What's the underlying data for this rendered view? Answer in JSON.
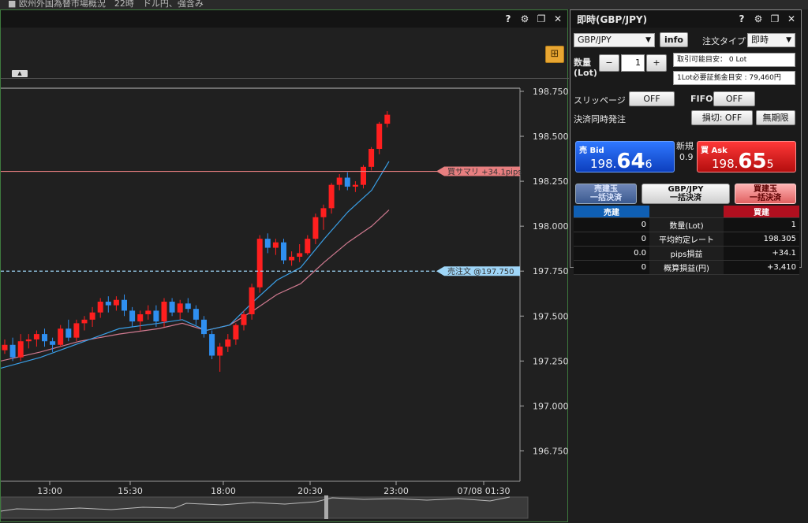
{
  "top_strip": {
    "text": "■ 欧州外国為替市場概況　22時　ドル円、強含み"
  },
  "chart_window": {
    "help": "?",
    "gear": "⚙",
    "restore": "❐",
    "close": "✕",
    "tile_icon": "⊞"
  },
  "chart_data": {
    "type": "candlestick",
    "y_ticks": [
      "198.750",
      "198.500",
      "198.250",
      "198.000",
      "197.750",
      "197.500",
      "197.250",
      "197.000",
      "196.750"
    ],
    "x_ticks": [
      "13:00",
      "15:30",
      "18:00",
      "20:30",
      "23:00",
      "07/08 01:30"
    ],
    "ylim": [
      196.66,
      198.82
    ],
    "candles": [
      [
        197.31,
        197.37,
        197.29,
        197.34
      ],
      [
        197.34,
        197.38,
        197.25,
        197.27
      ],
      [
        197.27,
        197.4,
        197.25,
        197.36
      ],
      [
        197.36,
        197.4,
        197.32,
        197.37
      ],
      [
        197.37,
        197.42,
        197.33,
        197.4
      ],
      [
        197.4,
        197.43,
        197.33,
        197.36
      ],
      [
        197.36,
        197.38,
        197.3,
        197.34
      ],
      [
        197.34,
        197.45,
        197.33,
        197.43
      ],
      [
        197.43,
        197.48,
        197.36,
        197.38
      ],
      [
        197.38,
        197.48,
        197.36,
        197.46
      ],
      [
        197.46,
        197.5,
        197.42,
        197.48
      ],
      [
        197.48,
        197.55,
        197.44,
        197.52
      ],
      [
        197.52,
        197.6,
        197.49,
        197.58
      ],
      [
        197.58,
        197.61,
        197.52,
        197.56
      ],
      [
        197.56,
        197.61,
        197.53,
        197.59
      ],
      [
        197.59,
        197.62,
        197.5,
        197.53
      ],
      [
        197.53,
        197.55,
        197.44,
        197.47
      ],
      [
        197.47,
        197.53,
        197.42,
        197.51
      ],
      [
        197.51,
        197.56,
        197.48,
        197.53
      ],
      [
        197.53,
        197.56,
        197.44,
        197.47
      ],
      [
        197.47,
        197.6,
        197.44,
        197.58
      ],
      [
        197.58,
        197.6,
        197.5,
        197.52
      ],
      [
        197.52,
        197.59,
        197.48,
        197.57
      ],
      [
        197.57,
        197.6,
        197.52,
        197.54
      ],
      [
        197.54,
        197.56,
        197.45,
        197.48
      ],
      [
        197.48,
        197.5,
        197.38,
        197.4
      ],
      [
        197.4,
        197.42,
        197.26,
        197.28
      ],
      [
        197.28,
        197.35,
        197.19,
        197.33
      ],
      [
        197.33,
        197.4,
        197.3,
        197.37
      ],
      [
        197.37,
        197.46,
        197.34,
        197.45
      ],
      [
        197.45,
        197.53,
        197.42,
        197.51
      ],
      [
        197.51,
        197.68,
        197.48,
        197.66
      ],
      [
        197.66,
        197.95,
        197.63,
        197.93
      ],
      [
        197.93,
        197.96,
        197.85,
        197.88
      ],
      [
        197.88,
        197.93,
        197.84,
        197.91
      ],
      [
        197.91,
        197.93,
        197.79,
        197.81
      ],
      [
        197.81,
        197.86,
        197.78,
        197.83
      ],
      [
        197.83,
        197.9,
        197.8,
        197.85
      ],
      [
        197.85,
        197.95,
        197.84,
        197.93
      ],
      [
        197.93,
        198.07,
        197.9,
        198.05
      ],
      [
        198.05,
        198.12,
        197.98,
        198.1
      ],
      [
        198.1,
        198.24,
        198.07,
        198.23
      ],
      [
        198.23,
        198.29,
        198.2,
        198.27
      ],
      [
        198.27,
        198.3,
        198.2,
        198.22
      ],
      [
        198.22,
        198.25,
        198.19,
        198.23
      ],
      [
        198.23,
        198.34,
        198.21,
        198.33
      ],
      [
        198.33,
        198.44,
        198.31,
        198.43
      ],
      [
        198.43,
        198.58,
        198.4,
        198.57
      ],
      [
        198.57,
        198.64,
        198.55,
        198.62
      ]
    ],
    "ma_fast": [
      [
        0,
        197.21
      ],
      [
        50,
        197.27
      ],
      [
        100,
        197.35
      ],
      [
        150,
        197.43
      ],
      [
        200,
        197.46
      ],
      [
        230,
        197.48
      ],
      [
        260,
        197.42
      ],
      [
        290,
        197.45
      ],
      [
        320,
        197.58
      ],
      [
        350,
        197.7
      ],
      [
        380,
        197.77
      ],
      [
        410,
        197.93
      ],
      [
        440,
        198.08
      ],
      [
        470,
        198.2
      ],
      [
        492,
        198.36
      ]
    ],
    "ma_slow": [
      [
        0,
        197.25
      ],
      [
        50,
        197.3
      ],
      [
        100,
        197.36
      ],
      [
        150,
        197.4
      ],
      [
        200,
        197.43
      ],
      [
        230,
        197.46
      ],
      [
        260,
        197.42
      ],
      [
        290,
        197.45
      ],
      [
        320,
        197.53
      ],
      [
        350,
        197.62
      ],
      [
        380,
        197.68
      ],
      [
        410,
        197.8
      ],
      [
        440,
        197.91
      ],
      [
        470,
        198.0
      ],
      [
        492,
        198.09
      ]
    ],
    "hlines": [
      {
        "y": 198.305,
        "label": "買サマリ +34.1pips",
        "color": "#e87f80"
      },
      {
        "y": 197.75,
        "label": "売注文 @197.750",
        "color": "#9fd6f8"
      }
    ],
    "grid": false
  },
  "trade": {
    "title": "即時(GBP/JPY)",
    "help": "?",
    "gear": "⚙",
    "restore": "❐",
    "close": "✕",
    "pair": "GBP/JPY",
    "info": "info",
    "order_type_label": "注文タイプ",
    "order_type": "即時",
    "qty_label": "数量",
    "qty_unit": "(Lot)",
    "minus": "−",
    "plus": "+",
    "qty": "1",
    "tradable": "取引可能目安： 0 Lot",
    "margin": "1Lot必要証拠金目安 : 79,460円",
    "slippage_label": "スリッページ",
    "slippage": "OFF",
    "fifo_label": "FIFO",
    "fifo": "OFF",
    "settle_label": "決済同時発注",
    "stoploss": "損切: OFF",
    "expiry": "無期限",
    "bid_label": "売 Bid",
    "bid_pre": "198.",
    "bid_big": "64",
    "bid_last": "6",
    "spread_label": "新規",
    "spread": "0.9",
    "ask_label": "買 Ask",
    "ask_pre": "198.",
    "ask_big": "65",
    "ask_last": "5",
    "close_sell_1": "売建玉",
    "close_sell_2": "一括決済",
    "close_pair_1": "GBP/JPY",
    "close_pair_2": "一括決済",
    "close_buy_1": "買建玉",
    "close_buy_2": "一括決済",
    "sell_header": "売建",
    "buy_header": "買建",
    "rows": [
      {
        "sell": "0",
        "label": "数量(Lot)",
        "buy": "1"
      },
      {
        "sell": "0",
        "label": "平均約定レート",
        "buy": "198.305"
      },
      {
        "sell": "0.0",
        "label": "pips損益",
        "buy": "+34.1"
      },
      {
        "sell": "0",
        "label": "概算損益(円)",
        "buy": "+3,410"
      }
    ]
  },
  "colors": {
    "up": "#ff1f1f",
    "down": "#2f8ff0",
    "ma_fast": "#3aa0e8",
    "ma_slow": "#d07a90"
  }
}
